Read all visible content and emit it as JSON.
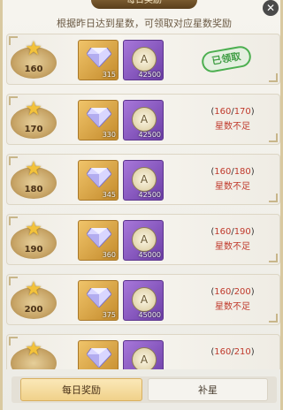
{
  "header": {
    "title": "每日奖励",
    "hint": "根据昨日达到星数，可领取对应星数奖励"
  },
  "close_label": "✕",
  "rows": [
    {
      "stars": "160",
      "gem_qty": "315",
      "coin_qty": "42500",
      "claimed_label": "已领取"
    },
    {
      "stars": "170",
      "gem_qty": "330",
      "coin_qty": "42500",
      "current": "160",
      "target": "170",
      "status": "星数不足"
    },
    {
      "stars": "180",
      "gem_qty": "345",
      "coin_qty": "42500",
      "current": "160",
      "target": "180",
      "status": "星数不足"
    },
    {
      "stars": "190",
      "gem_qty": "360",
      "coin_qty": "45000",
      "current": "160",
      "target": "190",
      "status": "星数不足"
    },
    {
      "stars": "200",
      "gem_qty": "375",
      "coin_qty": "45000",
      "current": "160",
      "target": "200",
      "status": "星数不足"
    },
    {
      "stars": "210",
      "current": "160",
      "target": "210"
    }
  ],
  "tabs": {
    "daily": "每日奖励",
    "extra": "补星"
  },
  "colors": {
    "gem_bg": "#c48b2c",
    "coin_bg": "#6d3fa8",
    "warn": "#c0392b",
    "claimed": "#3f9d44"
  }
}
